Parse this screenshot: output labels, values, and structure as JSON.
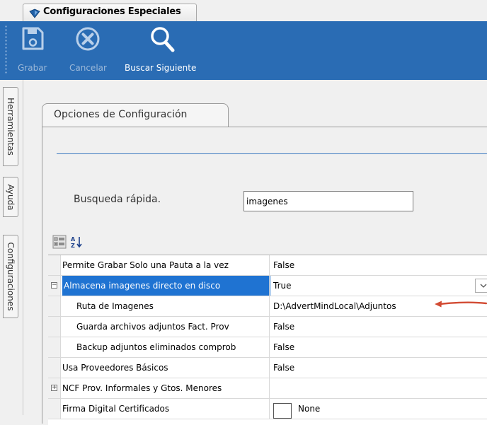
{
  "window": {
    "doc_tab": {
      "label": "Configuraciones Especiales",
      "icon": "shield-icon",
      "icon_color": "#1f5fa6"
    }
  },
  "colors": {
    "ribbon": "#2a6cb4",
    "selection": "#1f73d2",
    "arrow": "#d24b33"
  },
  "toolbar": {
    "save": {
      "label": "Grabar",
      "icon": "floppy-disk-icon",
      "enabled": false
    },
    "cancel": {
      "label": "Cancelar",
      "icon": "cancel-circle-icon",
      "enabled": false
    },
    "find_next": {
      "label": "Buscar Siguiente",
      "icon": "magnifier-icon",
      "enabled": true
    }
  },
  "side_tabs": [
    {
      "label": "Herramientas"
    },
    {
      "label": "Ayuda"
    },
    {
      "label": "Configuraciones"
    }
  ],
  "config": {
    "tab_label": "Opciones de Configuración",
    "search": {
      "label": "Busqueda rápida.",
      "value": "imagenes"
    },
    "grid_toolbar": {
      "categorized_icon": "categorized-icon",
      "alphabetical_icon": "sort-az-icon"
    },
    "rows": [
      {
        "name": "Permite Grabar Solo una Pauta a la vez",
        "value": "False"
      },
      {
        "name": "Almacena imagenes directo en disco",
        "value": "True",
        "expander": "⊟",
        "selected": true,
        "has_dropdown": true
      },
      {
        "name": "Ruta de Imagenes",
        "value": "D:\\AdvertMindLocal\\Adjuntos",
        "child": true,
        "annotated": true
      },
      {
        "name": "Guarda archivos adjuntos Fact. Prov",
        "value": "False",
        "child": true
      },
      {
        "name": "Backup adjuntos eliminados comprob",
        "value": "False",
        "child": true
      },
      {
        "name": "Usa Proveedores Básicos",
        "value": "False"
      },
      {
        "name": "NCF Prov. Informales y Gtos. Menores",
        "value": "",
        "expander": "⊞"
      },
      {
        "name": "Firma Digital Certificados",
        "value": "None",
        "checkbox": true
      }
    ]
  }
}
